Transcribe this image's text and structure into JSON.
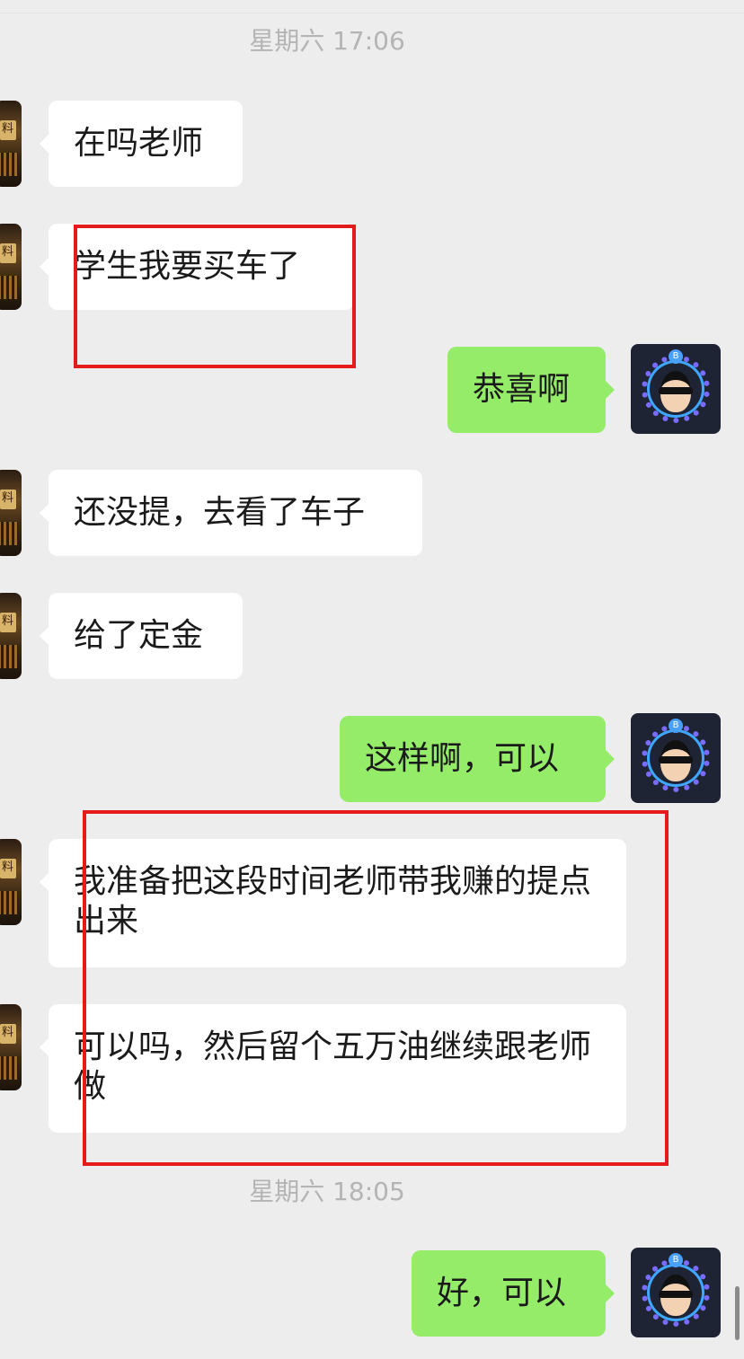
{
  "timestamps": [
    "星期六 17:06",
    "星期六 18:05"
  ],
  "messages": [
    {
      "from": "contact",
      "text": "在吗老师"
    },
    {
      "from": "contact",
      "text": "学生我要买车了"
    },
    {
      "from": "me",
      "text": "恭喜啊"
    },
    {
      "from": "contact",
      "text": "还没提，去看了车子"
    },
    {
      "from": "contact",
      "text": "给了定金"
    },
    {
      "from": "me",
      "text": "这样啊，可以"
    },
    {
      "from": "contact",
      "text": "我准备把这段时间老师带我赚的提点出来"
    },
    {
      "from": "contact",
      "text": "可以吗，然后留个五万油继续跟老师做"
    },
    {
      "from": "me",
      "text": "好，可以"
    }
  ],
  "avatars": {
    "contact": {
      "icon": "temple-gate-icon",
      "glyph": "料"
    },
    "me": {
      "icon": "bitcoin-sunglasses-avatar-icon",
      "coin": "B"
    }
  },
  "highlight_color": "#e21b1b",
  "bubble_colors": {
    "incoming": "#ffffff",
    "outgoing": "#95ec69"
  }
}
